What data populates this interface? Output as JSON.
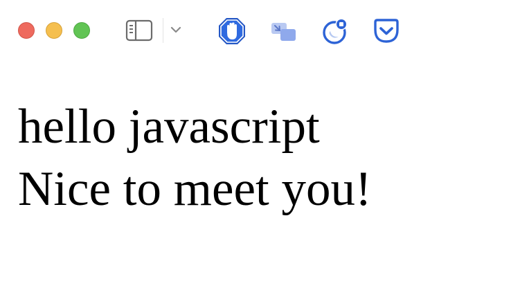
{
  "toolbar": {
    "traffic_lights": {
      "close_color": "#ee6a5e",
      "minimize_color": "#f5bf4f",
      "maximize_color": "#61c454"
    },
    "buttons": [
      {
        "name": "sidebar-toggle",
        "icon": "sidebar-icon"
      },
      {
        "name": "tab-overview-menu",
        "icon": "chevron-down-icon"
      },
      {
        "name": "adblock-extension",
        "icon": "stop-hand-icon"
      },
      {
        "name": "picture-in-picture-extension",
        "icon": "pip-icon"
      },
      {
        "name": "dark-mode-extension",
        "icon": "moon-badge-icon"
      },
      {
        "name": "pocket-extension",
        "icon": "pocket-icon"
      }
    ],
    "accent_color": "#2b5fd9"
  },
  "page": {
    "lines": [
      "hello javascript",
      "Nice to meet you!"
    ]
  }
}
